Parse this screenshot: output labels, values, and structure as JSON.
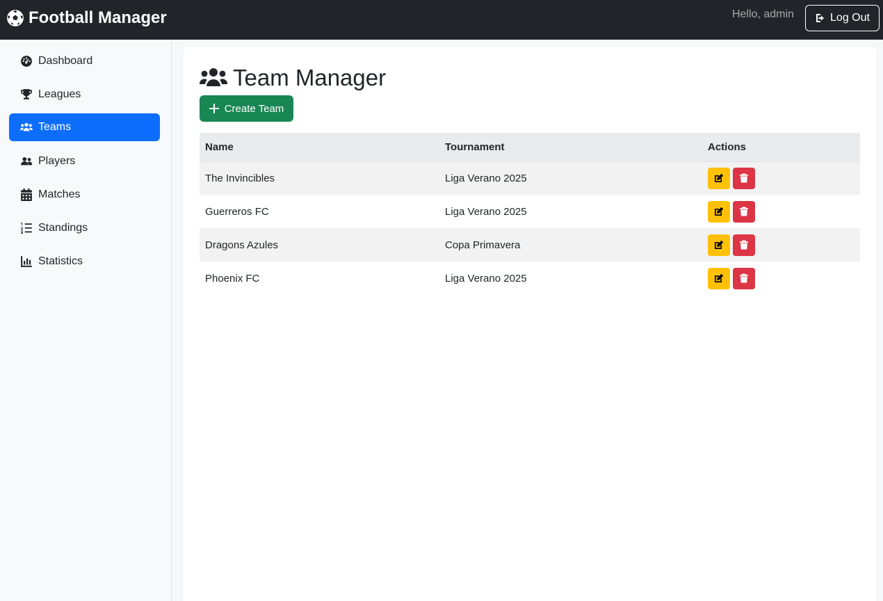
{
  "app": {
    "title": "Football Manager"
  },
  "header": {
    "greeting": "Hello, admin",
    "logout_label": "Log Out"
  },
  "sidebar": {
    "items": [
      {
        "label": "Dashboard",
        "icon": "dashboard-gauge-icon",
        "active": false
      },
      {
        "label": "Leagues",
        "icon": "trophy-icon",
        "active": false
      },
      {
        "label": "Teams",
        "icon": "users-icon",
        "active": true
      },
      {
        "label": "Players",
        "icon": "user-group-icon",
        "active": false
      },
      {
        "label": "Matches",
        "icon": "calendar-icon",
        "active": false
      },
      {
        "label": "Standings",
        "icon": "ordered-list-icon",
        "active": false
      },
      {
        "label": "Statistics",
        "icon": "bar-chart-icon",
        "active": false
      }
    ]
  },
  "main": {
    "title": "Team Manager",
    "create_label": "Create Team",
    "table": {
      "headers": [
        "Name",
        "Tournament",
        "Actions"
      ],
      "rows": [
        {
          "name": "The Invincibles",
          "tournament": "Liga Verano 2025"
        },
        {
          "name": "Guerreros FC",
          "tournament": "Liga Verano 2025"
        },
        {
          "name": "Dragons Azules",
          "tournament": "Copa Primavera"
        },
        {
          "name": "Phoenix FC",
          "tournament": "Liga Verano 2025"
        }
      ]
    }
  },
  "colors": {
    "navbar": "#212529",
    "active": "#0d6efd",
    "success": "#198754",
    "warning": "#ffc107",
    "danger": "#dc3545"
  }
}
